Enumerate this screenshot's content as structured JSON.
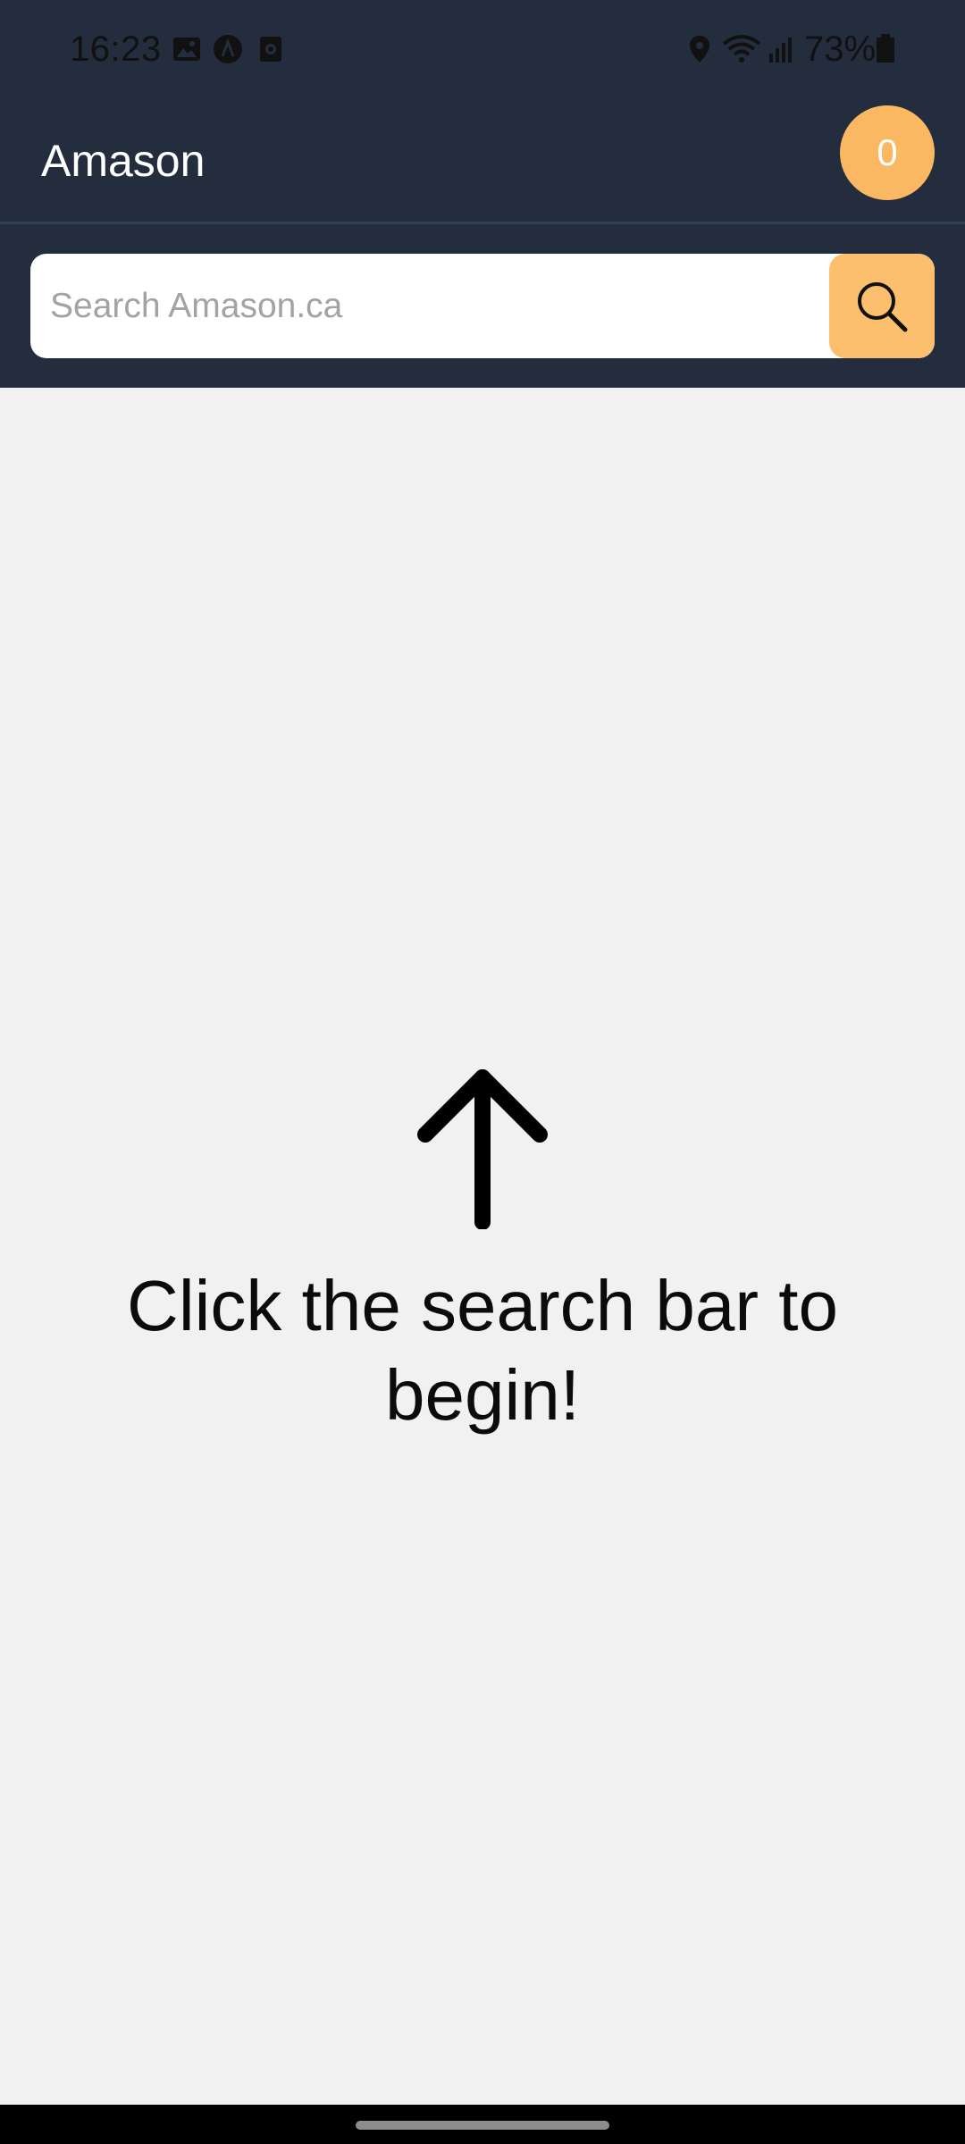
{
  "status_bar": {
    "time": "16:23",
    "battery": "73%",
    "left_icons": [
      "gallery-icon",
      "app-a-icon",
      "app-box-icon"
    ],
    "right_icons": [
      "location-icon",
      "wifi-icon",
      "signal-icon",
      "battery-icon"
    ]
  },
  "header": {
    "title": "Amason",
    "cart_count": "0"
  },
  "search": {
    "placeholder": "Search Amason.ca",
    "button_icon": "search-icon"
  },
  "empty_state": {
    "icon": "arrow-up-icon",
    "message": "Click the search bar to begin!"
  },
  "colors": {
    "header_bg": "#232d3e",
    "accent": "#fbb863",
    "content_bg": "#f1f1f1"
  }
}
